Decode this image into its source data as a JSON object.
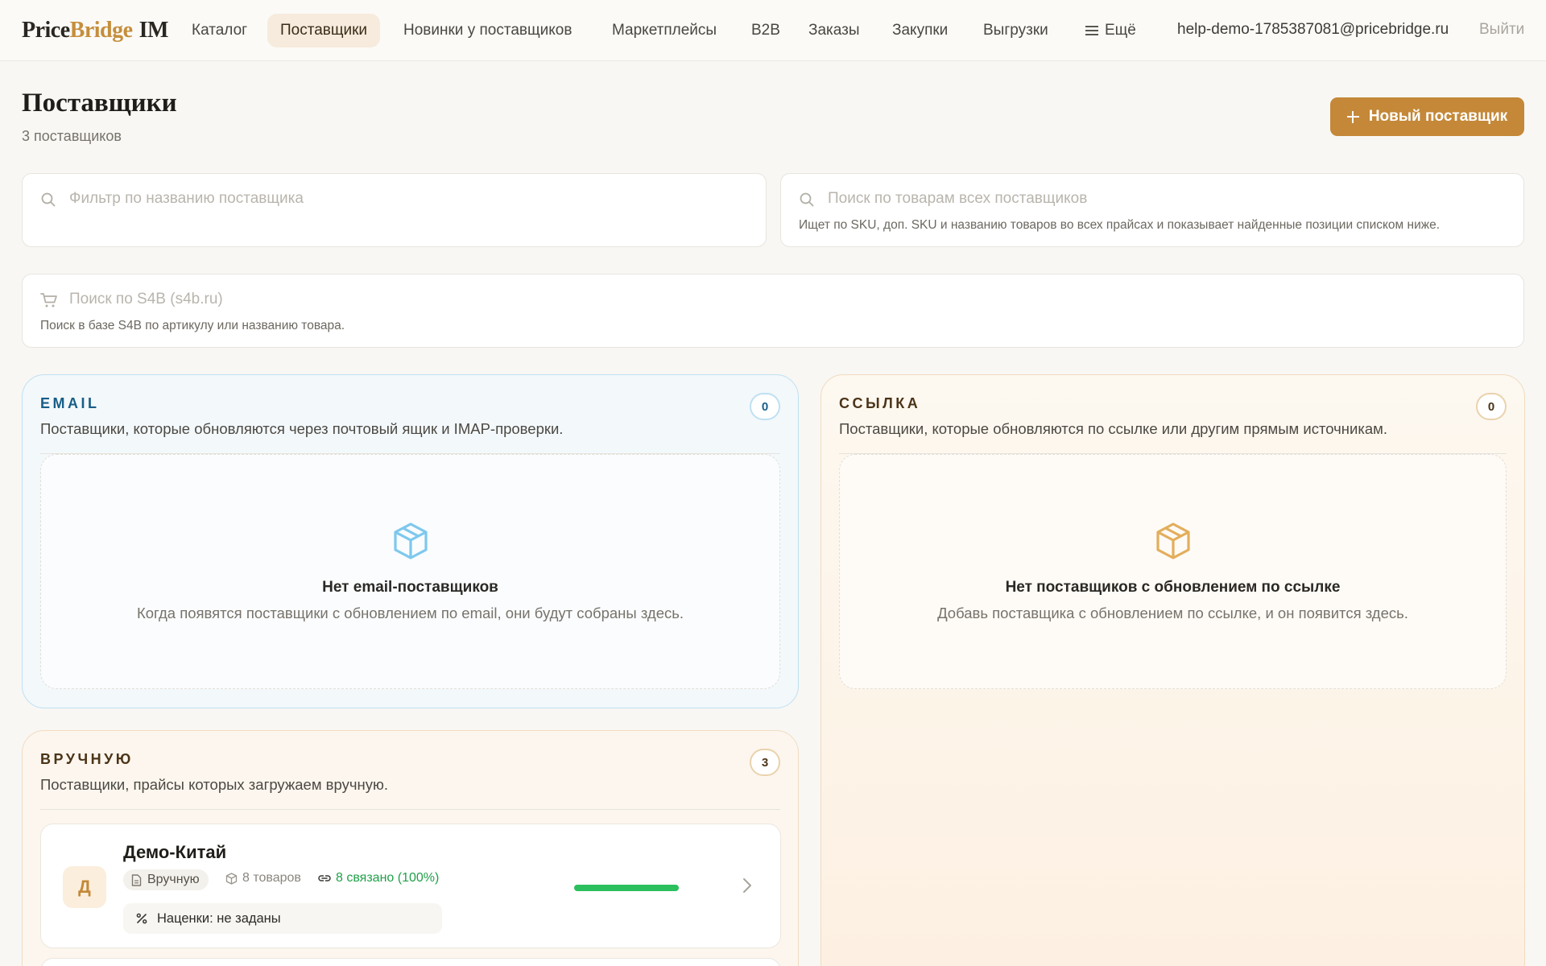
{
  "nav": {
    "logo_a": "Price",
    "logo_b": "Bridge",
    "logo_c": "IM",
    "items": [
      "Каталог",
      "Поставщики",
      "Новинки у поставщиков",
      "Маркетплейсы",
      "B2B",
      "Заказы",
      "Закупки",
      "Выгрузки"
    ],
    "active_item": "Поставщики",
    "more_label": "Ещё",
    "user_email": "help-demo-1785387081@pricebridge.ru",
    "logout_label": "Выйти"
  },
  "header": {
    "title": "Поставщики",
    "subtitle": "3 поставщиков",
    "new_button_label": "Новый поставщик"
  },
  "search": {
    "supplier_filter_placeholder": "Фильтр по названию поставщика",
    "product_search_placeholder": "Поиск по товарам всех поставщиков",
    "product_search_hint": "Ищет по SKU, доп. SKU и названию товаров во всех прайсах и показывает найденные позиции списком ниже.",
    "s4b_placeholder": "Поиск по S4B (s4b.ru)",
    "s4b_hint": "Поиск в базе S4B по артикулу или названию товара."
  },
  "sections": {
    "email": {
      "title": "EMAIL",
      "description": "Поставщики, которые обновляются через почтовый ящик и IMAP-проверки.",
      "count": "0",
      "empty_title": "Нет email-поставщиков",
      "empty_description": "Когда появятся поставщики с обновлением по email, они будут собраны здесь.",
      "accent": "#175e88"
    },
    "link": {
      "title": "ССЫЛКА",
      "description": "Поставщики, которые обновляются по ссылке или другим прямым источникам.",
      "count": "0",
      "empty_title": "Нет поставщиков с обновлением по ссылке",
      "empty_description": "Добавь поставщика с обновлением по ссылке, и он появится здесь.",
      "accent": "#c48838"
    },
    "manual": {
      "title": "ВРУЧНУЮ",
      "description": "Поставщики, прайсы которых загружаем вручную.",
      "count": "3",
      "suppliers": [
        {
          "initial": "Д",
          "name": "Демо-Китай",
          "mode": "Вручную",
          "items": "8 товаров",
          "linked": "8 связано (100%)",
          "linked_fraction": 1.0,
          "markup": "Наценки: не заданы"
        }
      ]
    }
  },
  "colors": {
    "primary": "#c48838",
    "success": "#2bbf5e",
    "email_border": "#bfe0f2",
    "link_border": "#f1dbbf"
  }
}
